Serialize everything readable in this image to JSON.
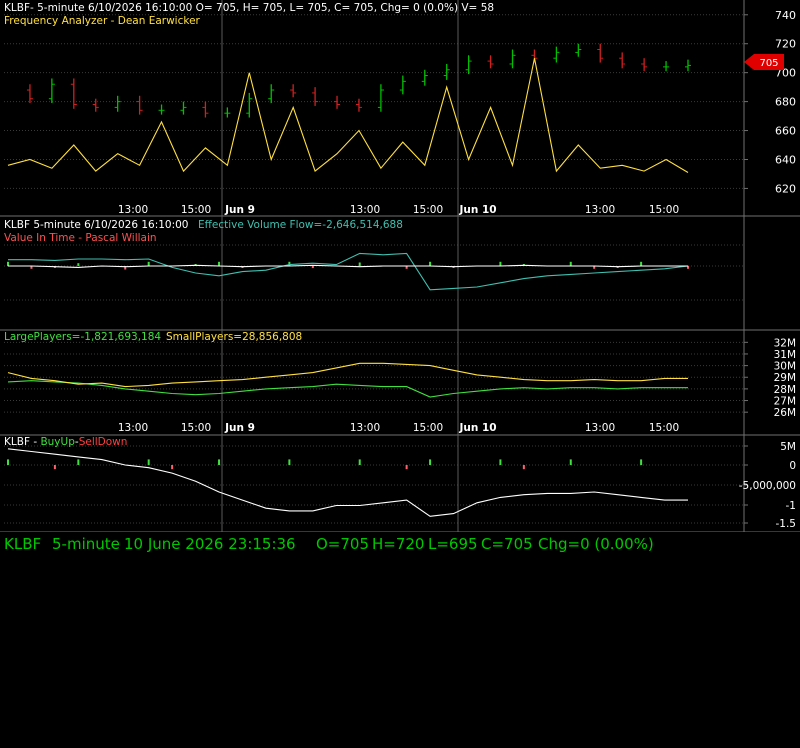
{
  "colors": {
    "background": "#000000",
    "grid": "#3a3a3a",
    "separator": "#707070",
    "bull": "#00c000",
    "bear": "#d02020",
    "yellow": "#ffe040",
    "cyan": "#40c0b0",
    "green": "#40e040",
    "white": "#ffffff",
    "pink": "#ff6070",
    "status_green": "#00c800",
    "price_tag": "#e00000"
  },
  "panel1": {
    "header": "KLBF- 5-minute 6/10/2026 16:10:00 O= 705, H= 705, L= 705, C= 705, Chg= 0 (0.0%) V= 58",
    "subheader": "Frequency Analyzer - Dean Earwicker",
    "price_tag": "705",
    "x_tick_labels": [
      "13:00",
      "15:00",
      "Jun 9",
      "13:00",
      "15:00",
      "Jun 10",
      "13:00",
      "15:00"
    ]
  },
  "panel2": {
    "header_left": "KLBF 5-minute  6/10/2026 16:10:00",
    "header_right": "Effective Volume Flow=-2,646,514,688",
    "subheader": "Value In Time - Pascal Willain"
  },
  "panel3": {
    "large_label": "LargePlayers=-1,821,693,184",
    "small_label": "SmallPlayers=28,856,808",
    "x_tick_labels": [
      "13:00",
      "15:00",
      "Jun 9",
      "13:00",
      "15:00",
      "Jun 10",
      "13:00",
      "15:00"
    ]
  },
  "panel4": {
    "title_prefix": "KLBF - ",
    "buy_label": "BuyUp",
    "separator": "-",
    "sell_label": "SellDown"
  },
  "status": {
    "symbol": "KLBF",
    "interval": "5-minute",
    "datetime": "10 June 2026 23:15:36",
    "open": "O=705",
    "high": "H=720",
    "low": "L=695",
    "close": "C=705",
    "change": "Chg=0 (0.00%)"
  },
  "chart_data": [
    {
      "type": "line",
      "title": "KLBF 5-minute price with Frequency Analyzer",
      "y_tick_labels": [
        "740",
        "720",
        "700",
        "680",
        "660",
        "640",
        "620"
      ],
      "ylim": [
        612,
        744
      ],
      "x": [
        "Jun 8 13:00",
        "Jun 8 15:00",
        "Jun 9",
        "Jun 9 13:00",
        "Jun 9 15:00",
        "Jun 10",
        "Jun 10 13:00",
        "Jun 10 15:00"
      ],
      "series": [
        {
          "name": "Price",
          "style": "bars",
          "values": [
            688,
            682,
            692,
            678,
            676,
            680,
            674,
            674,
            676,
            672,
            672,
            682,
            688,
            686,
            680,
            678,
            676,
            688,
            694,
            698,
            702,
            708,
            706,
            712,
            710,
            714,
            716,
            710,
            706,
            704,
            704,
            705
          ]
        },
        {
          "name": "Frequency Analyzer",
          "values": [
            636,
            640,
            634,
            650,
            632,
            644,
            636,
            666,
            632,
            648,
            636,
            700,
            640,
            676,
            632,
            644,
            660,
            634,
            652,
            636,
            690,
            640,
            676,
            636,
            710,
            632,
            650,
            634,
            636,
            632,
            640,
            631
          ]
        }
      ]
    },
    {
      "type": "line",
      "title": "Effective Volume Flow / Value In Time",
      "series": [
        {
          "name": "Effective Volume Flow",
          "values": [
            0.45,
            0.45,
            0.4,
            0.5,
            0.5,
            0.45,
            0.5,
            -0.1,
            -0.5,
            -0.7,
            -0.4,
            -0.3,
            0.1,
            0.2,
            0.1,
            0.9,
            0.8,
            0.9,
            -1.7,
            -1.6,
            -1.5,
            -1.2,
            -0.9,
            -0.7,
            -0.6,
            -0.5,
            -0.4,
            -0.3,
            -0.2,
            0.0
          ]
        },
        {
          "name": "Value In Time",
          "values": [
            0.0,
            0.0,
            -0.05,
            -0.1,
            0.0,
            -0.05,
            0.0,
            0.0,
            0.05,
            0.0,
            -0.05,
            0.0,
            0.0,
            0.05,
            0.0,
            -0.05,
            0.0,
            0.0,
            0.0,
            -0.05,
            0.0,
            0.0,
            0.05,
            0.0,
            0.0,
            0.0,
            -0.05,
            0.0,
            0.0,
            0.0
          ]
        }
      ]
    },
    {
      "type": "line",
      "title": "LargePlayers / SmallPlayers",
      "y_tick_labels": [
        "32M",
        "31M",
        "30M",
        "29M",
        "28M",
        "27M",
        "26M"
      ],
      "ylim": [
        25.5,
        32.8
      ],
      "series": [
        {
          "name": "LargePlayers",
          "values": [
            28.6,
            28.7,
            28.6,
            28.5,
            28.3,
            28.0,
            27.8,
            27.6,
            27.5,
            27.6,
            27.8,
            28.0,
            28.1,
            28.2,
            28.4,
            28.3,
            28.2,
            28.2,
            27.3,
            27.6,
            27.8,
            28.0,
            28.1,
            28.0,
            28.1,
            28.1,
            28.0,
            28.1,
            28.1,
            28.1
          ]
        },
        {
          "name": "SmallPlayers",
          "values": [
            29.4,
            28.9,
            28.7,
            28.4,
            28.5,
            28.2,
            28.3,
            28.5,
            28.6,
            28.7,
            28.8,
            29.0,
            29.2,
            29.4,
            29.8,
            30.2,
            30.2,
            30.1,
            30.0,
            29.6,
            29.2,
            29.0,
            28.8,
            28.7,
            28.7,
            28.8,
            28.7,
            28.7,
            28.9,
            28.9
          ]
        }
      ]
    },
    {
      "type": "line",
      "title": "BuyUp - SellDown",
      "y_tick_labels": [
        "5M",
        "0",
        "-5,000,000",
        "-1",
        "-1.5"
      ],
      "series": [
        {
          "name": "BuyUp-SellDown cumulative",
          "values": [
            0.6,
            0.5,
            0.4,
            0.3,
            0.2,
            0.0,
            -0.1,
            -0.3,
            -0.6,
            -1.0,
            -1.3,
            -1.6,
            -1.7,
            -1.7,
            -1.5,
            -1.5,
            -1.4,
            -1.3,
            -1.9,
            -1.8,
            -1.4,
            -1.2,
            -1.1,
            -1.05,
            -1.05,
            -1.0,
            -1.1,
            -1.2,
            -1.3,
            -1.3
          ]
        }
      ]
    }
  ]
}
